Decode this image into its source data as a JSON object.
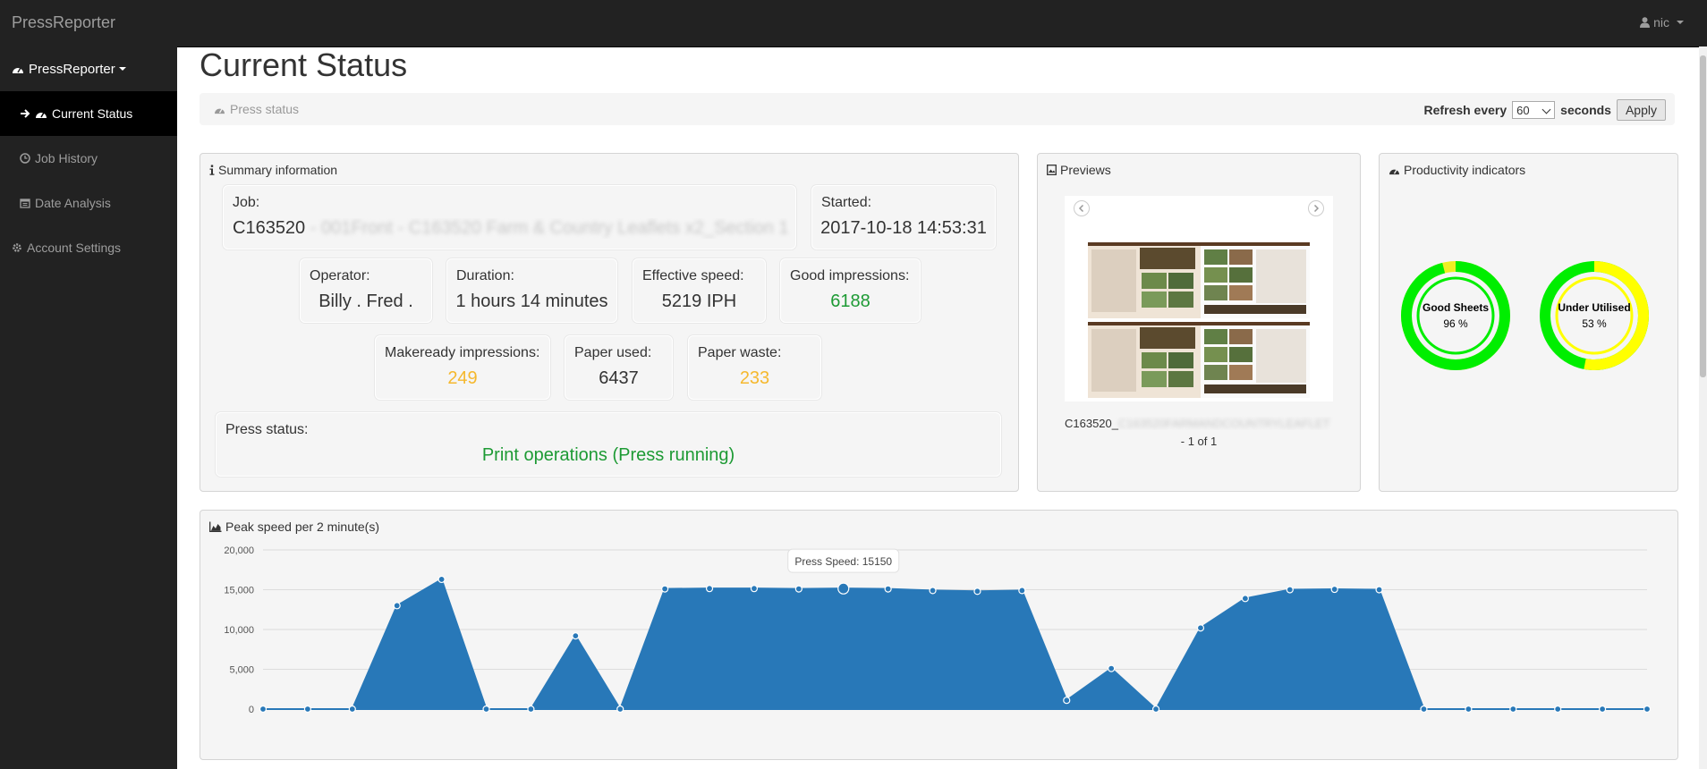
{
  "app": {
    "brand": "PressReporter",
    "user": "nic"
  },
  "sidebar": {
    "items": [
      {
        "label": "PressReporter",
        "icon": "dashboard-icon"
      },
      {
        "label": "Current Status",
        "icon": "dashboard-icon"
      },
      {
        "label": "Job History",
        "icon": "clock-icon"
      },
      {
        "label": "Date Analysis",
        "icon": "calendar-icon"
      },
      {
        "label": "Account Settings",
        "icon": "gear-icon"
      }
    ]
  },
  "page": {
    "title": "Current Status"
  },
  "breadcrumb": {
    "label": "Press status",
    "refresh_prefix": "Refresh every",
    "refresh_value": "60",
    "refresh_suffix": "seconds",
    "apply_label": "Apply"
  },
  "summary": {
    "title": "Summary information",
    "job_label": "Job:",
    "job_value": "C163520",
    "job_blurred": " - 001Front - C163520 Farm & Country Leaflets x2_Section 1",
    "started_label": "Started:",
    "started_value": "2017-10-18 14:53:31",
    "operator_label": "Operator:",
    "operator_value": "Billy . Fred .",
    "duration_label": "Duration:",
    "duration_value": "1 hours 14 minutes",
    "speed_label": "Effective speed:",
    "speed_value": "5219 IPH",
    "good_label": "Good impressions:",
    "good_value": "6188",
    "makeready_label": "Makeready impressions:",
    "makeready_value": "249",
    "paper_used_label": "Paper used:",
    "paper_used_value": "6437",
    "paper_waste_label": "Paper waste:",
    "paper_waste_value": "233",
    "press_status_label": "Press status:",
    "press_status_value": "Print operations (Press running)"
  },
  "previews": {
    "title": "Previews",
    "filename": "C163520_",
    "filename_blurred": "C163520FARMANDCOUNTRYLEAFLET",
    "pager": "- 1 of 1"
  },
  "productivity": {
    "title": "Productivity indicators",
    "gauges": [
      {
        "name": "Good Sheets",
        "value": "96 %",
        "fraction": 0.96,
        "color": "#00ee00",
        "rest": "#eeee22"
      },
      {
        "name": "Under Utilised",
        "value": "53 %",
        "fraction": 0.53,
        "color": "#ffff00",
        "rest": "#00ee00"
      }
    ]
  },
  "chart_data": {
    "type": "area",
    "title": "Peak speed per 2 minute(s)",
    "color": "#2878b8",
    "ylim": [
      0,
      20000
    ],
    "yticks": [
      "0",
      "5,000",
      "10,000",
      "15,000",
      "20,000"
    ],
    "values": [
      0,
      0,
      0,
      13000,
      16300,
      0,
      0,
      9200,
      0,
      15100,
      15150,
      15150,
      15100,
      15150,
      15100,
      14900,
      14800,
      14900,
      1100,
      5100,
      0,
      10200,
      13900,
      15000,
      15050,
      15000,
      0,
      0,
      0,
      0,
      0,
      0
    ],
    "grid": true,
    "tooltip": {
      "label": "Press Speed: 15150",
      "index": 13
    }
  },
  "colors": {
    "nav_bg": "#222222",
    "panel_bg": "#f5f5f5",
    "success": "#1d9a34",
    "warning": "#f5b82e"
  }
}
